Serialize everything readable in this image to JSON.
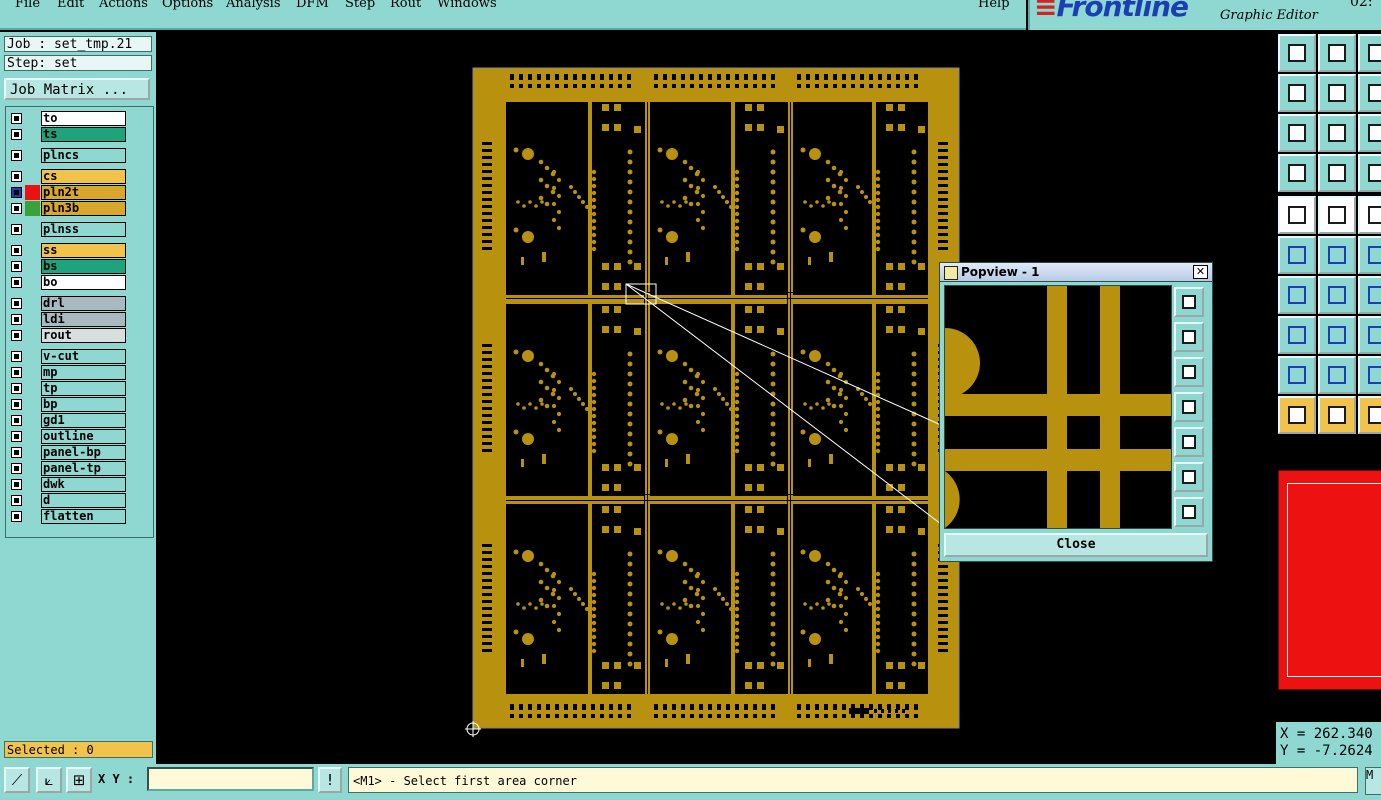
{
  "menu": {
    "items": [
      {
        "label": "File"
      },
      {
        "label": "Edit"
      },
      {
        "label": "Actions"
      },
      {
        "label": "Options"
      },
      {
        "label": "Analysis"
      },
      {
        "label": "DFM"
      },
      {
        "label": "Step"
      },
      {
        "label": "Rout"
      },
      {
        "label": "Windows"
      }
    ],
    "help": "Help"
  },
  "brand": {
    "logo": "Frontline",
    "subtitle": "Graphic Editor",
    "clock": "02:"
  },
  "job": {
    "label": "Job : set_tmp.21",
    "step": "Step: set",
    "matrix_button": "Job Matrix ..."
  },
  "layers": [
    {
      "name": "to",
      "color": "#ffffff"
    },
    {
      "name": "ts",
      "color": "#1fa37c"
    },
    {
      "name": "plncs",
      "color": "#8fd8d2"
    },
    {
      "name": "cs",
      "color": "#f2c34a"
    },
    {
      "name": "pln2t",
      "color": "#d9a72c",
      "swatch": "#ee1111",
      "active": true
    },
    {
      "name": "pln3b",
      "color": "#d9a72c",
      "swatch": "#3aa23a"
    },
    {
      "name": "plnss",
      "color": "#8fd8d2"
    },
    {
      "name": "ss",
      "color": "#f2c34a"
    },
    {
      "name": "bs",
      "color": "#1fa37c"
    },
    {
      "name": "bo",
      "color": "#ffffff"
    },
    {
      "name": "drl",
      "color": "#a9b9c0"
    },
    {
      "name": "ldi",
      "color": "#a9b9c0"
    },
    {
      "name": "rout",
      "color": "#d8dede"
    },
    {
      "name": "v-cut",
      "color": "#8fd8d2"
    },
    {
      "name": "mp",
      "color": "#8fd8d2"
    },
    {
      "name": "tp",
      "color": "#8fd8d2"
    },
    {
      "name": "bp",
      "color": "#8fd8d2"
    },
    {
      "name": "gd1",
      "color": "#8fd8d2"
    },
    {
      "name": "outline",
      "color": "#8fd8d2"
    },
    {
      "name": "panel-bp",
      "color": "#8fd8d2"
    },
    {
      "name": "panel-tp",
      "color": "#8fd8d2"
    },
    {
      "name": "dwk",
      "color": "#8fd8d2"
    },
    {
      "name": "d",
      "color": "#8fd8d2"
    },
    {
      "name": "flatten",
      "color": "#8fd8d2"
    }
  ],
  "selected": "Selected : 0",
  "status": {
    "xy_label": "X Y :",
    "xy_value": "",
    "prompt": "<M1> - Select first area corner",
    "m_button": "M"
  },
  "coords": {
    "x": "X = 262.340",
    "y": "Y = -7.2624"
  },
  "popview": {
    "title": "Popview - 1",
    "close": "Close"
  },
  "colors": {
    "copper": "#b8920e",
    "panel_bg": "#8fd8d2",
    "canvas_bg": "#000000"
  }
}
